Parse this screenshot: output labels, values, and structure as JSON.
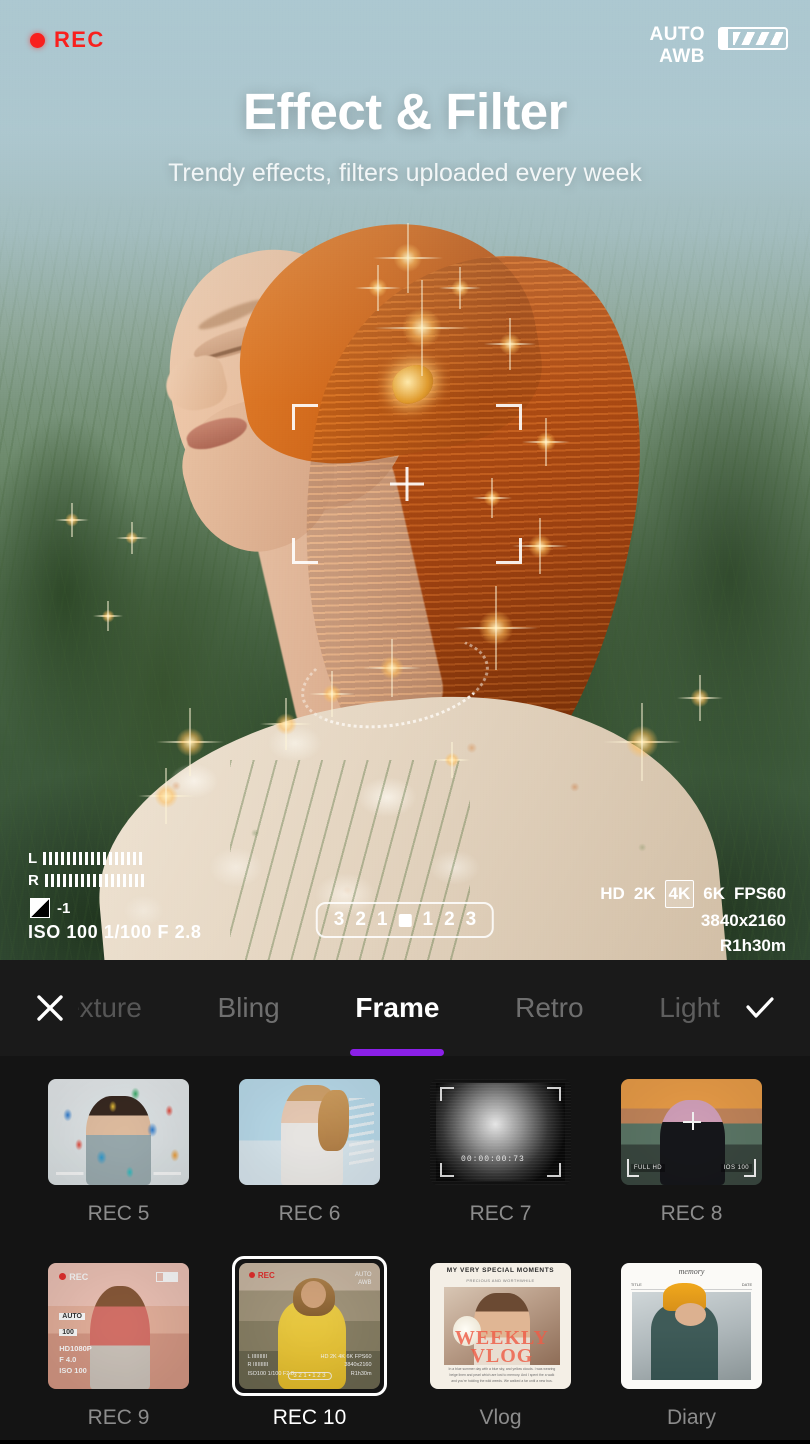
{
  "hero": {
    "title": "Effect & Filter",
    "subtitle": "Trendy effects, filters uploaded every week"
  },
  "camera_hud": {
    "rec_label": "REC",
    "auto_label": "AUTO",
    "awb_label": "AWB",
    "level_left": "L",
    "level_right": "R",
    "ev_value": "-1",
    "exposure_line": "ISO 100  1/100   F 2.8",
    "resolution_options": [
      "HD",
      "2K",
      "4K",
      "6K"
    ],
    "resolution_selected": "4K",
    "fps": "FPS60",
    "dimensions": "3840x2160",
    "remaining": "R1h30m",
    "zoom_scale": [
      "3",
      "2",
      "1",
      "1",
      "2",
      "3"
    ]
  },
  "toolbar": {
    "close_icon": "close-icon",
    "confirm_icon": "check-icon",
    "tabs": [
      {
        "label": "exture",
        "state": "clipped"
      },
      {
        "label": "Bling",
        "state": "inactive"
      },
      {
        "label": "Frame",
        "state": "active"
      },
      {
        "label": "Retro",
        "state": "inactive"
      },
      {
        "label": "Light",
        "state": "faded"
      }
    ],
    "active_tab": "Frame",
    "active_underline_color": "#8b20e8"
  },
  "frames": {
    "row1": [
      {
        "label": "REC 5",
        "selected": false
      },
      {
        "label": "REC 6",
        "selected": false
      },
      {
        "label": "REC 7",
        "selected": false
      },
      {
        "label": "REC 8",
        "selected": false
      }
    ],
    "row2": [
      {
        "label": "REC 9",
        "selected": false
      },
      {
        "label": "REC 10",
        "selected": true
      },
      {
        "label": "Vlog",
        "selected": false
      },
      {
        "label": "Diary",
        "selected": false
      }
    ]
  },
  "thumb_overlays": {
    "rec7_timecode": "00:00:00:73",
    "rec8_left": "FULL HD",
    "rec8_right": "IOS 100",
    "rec9_rec": "REC",
    "rec9_chip1": "AUTO",
    "rec9_chip2": "100",
    "rec9_meta": "HD1080P\nF 4.0\nISO 100",
    "rec10_rec": "REC",
    "rec10_tr": "AUTO\nAWB",
    "rec10_bl": "L IIIIIIIIII\nR IIIIIIIIII\nISO100 1/100 F2.8",
    "rec10_br": "HD 2K 4K 6K FPS60\n3840x2160\nR1h30m",
    "rec10_pill": "3 2 1 ▪ 1 2 3",
    "vlog_header": "MY VERY SPECIAL MOMENTS",
    "vlog_subheader": "PRECIOUS AND WORTHWHILE",
    "vlog_big": "WEEKLY VLOG",
    "vlog_body": "In a blue summer day with a blue sky, and yellow clouds. I was wearing beige linen and pearl which are lost to memory. And I spent the a walk and you're holding the wild weeds. We walked a far until a new bus.",
    "diary_script": "memory",
    "diary_title_label": "TITLE",
    "diary_date_label": "DATE"
  }
}
